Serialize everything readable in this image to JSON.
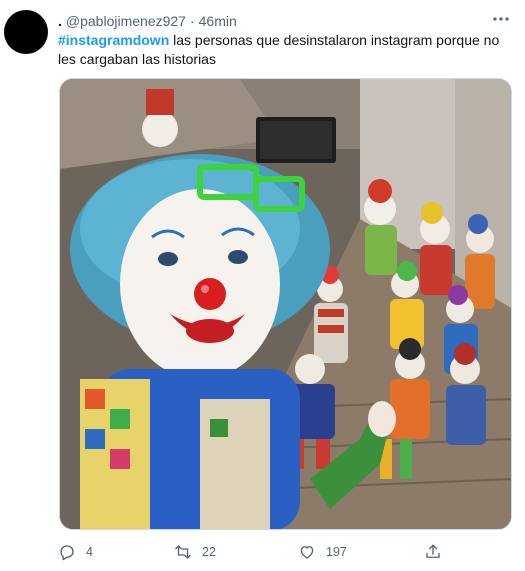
{
  "tweet": {
    "display_name": ".",
    "handle": "@pablojimenez927",
    "separator": "·",
    "time": "46min",
    "hashtag": "#instagramdown",
    "body": " las personas que desinstalaron instagram porque no les cargaban las historias",
    "media": {
      "description_icon": "photo-icon"
    }
  },
  "actions": {
    "replies": "4",
    "retweets": "22",
    "likes": "197"
  },
  "icons": {
    "more": "more-icon",
    "reply": "reply-icon",
    "retweet": "retweet-icon",
    "like": "heart-icon",
    "share": "share-icon"
  },
  "colors": {
    "accent": "#1d9bf0",
    "muted": "#536471",
    "text": "#0f1419"
  }
}
